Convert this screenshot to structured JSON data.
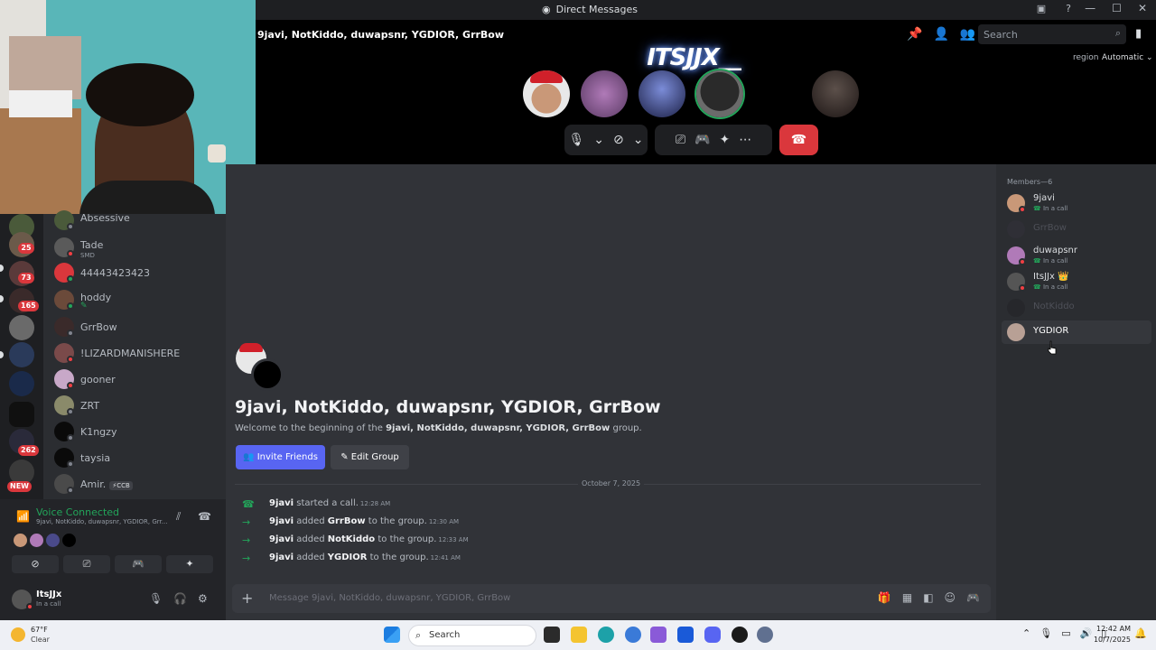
{
  "window": {
    "title": "Direct Messages"
  },
  "call": {
    "group_name": "9javi, NotKiddo, duwapsnr, YGDIOR, GrrBow",
    "logo_text": "ITSJJX__",
    "search_placeholder": "Search",
    "region_label": "region",
    "region_value": "Automatic"
  },
  "dms": [
    {
      "name": "Absessive",
      "sub": ""
    },
    {
      "name": "Tade",
      "sub": "SMD"
    },
    {
      "name": "44443423423",
      "sub": ""
    },
    {
      "name": "hoddy",
      "sub": "✎"
    },
    {
      "name": "GrrBow",
      "sub": ""
    },
    {
      "name": "!LIZARDMANISHERE",
      "sub": ""
    },
    {
      "name": "gooner",
      "sub": ""
    },
    {
      "name": "ZRT",
      "sub": ""
    },
    {
      "name": "K1ngzy",
      "sub": ""
    },
    {
      "name": "taysia",
      "sub": ""
    },
    {
      "name": "Amir.",
      "sub": "",
      "tag": "⚡CCB"
    }
  ],
  "rail": {
    "badges": [
      "25",
      "73",
      "165",
      "262"
    ],
    "new_label": "NEW"
  },
  "voice": {
    "status": "Voice Connected",
    "channel": "9javi, NotKiddo, duwapsnr, YGDIOR, Grr..."
  },
  "user": {
    "name": "ItsJJx",
    "status": "In a call"
  },
  "chat": {
    "title": "9javi, NotKiddo, duwapsnr, YGDIOR, GrrBow",
    "welcome_prefix": "Welcome to the beginning of the ",
    "welcome_group": "9javi, NotKiddo, duwapsnr, YGDIOR, GrrBow",
    "welcome_suffix": " group.",
    "invite_label": "Invite Friends",
    "edit_label": "Edit Group",
    "date_divider": "October 7, 2025",
    "messages": [
      {
        "actor": "9javi",
        "text": " started a call.",
        "target": "",
        "tail": "",
        "time": "12:28 AM"
      },
      {
        "actor": "9javi",
        "text": " added ",
        "target": "GrrBow",
        "tail": " to the group.",
        "time": "12:30 AM"
      },
      {
        "actor": "9javi",
        "text": " added ",
        "target": "NotKiddo",
        "tail": " to the group.",
        "time": "12:33 AM"
      },
      {
        "actor": "9javi",
        "text": " added ",
        "target": "YGDIOR",
        "tail": " to the group.",
        "time": "12:41 AM"
      }
    ],
    "composer_placeholder": "Message 9javi, NotKiddo, duwapsnr, YGDIOR, GrrBow"
  },
  "members": {
    "title": "Members—6",
    "list": [
      {
        "name": "9javi",
        "sub": "In a call"
      },
      {
        "name": "GrrBow",
        "sub": ""
      },
      {
        "name": "duwapsnr",
        "sub": "In a call"
      },
      {
        "name": "ItsJJx 👑",
        "sub": "In a call"
      },
      {
        "name": "NotKiddo",
        "sub": ""
      },
      {
        "name": "YGDIOR",
        "sub": ""
      }
    ]
  },
  "taskbar": {
    "temperature": "67°F",
    "condition": "Clear",
    "search": "Search",
    "time": "12:42 AM",
    "date": "10/7/2025"
  },
  "colors": {
    "accent": "#5865f2",
    "green": "#23a55a",
    "red": "#da373c"
  }
}
